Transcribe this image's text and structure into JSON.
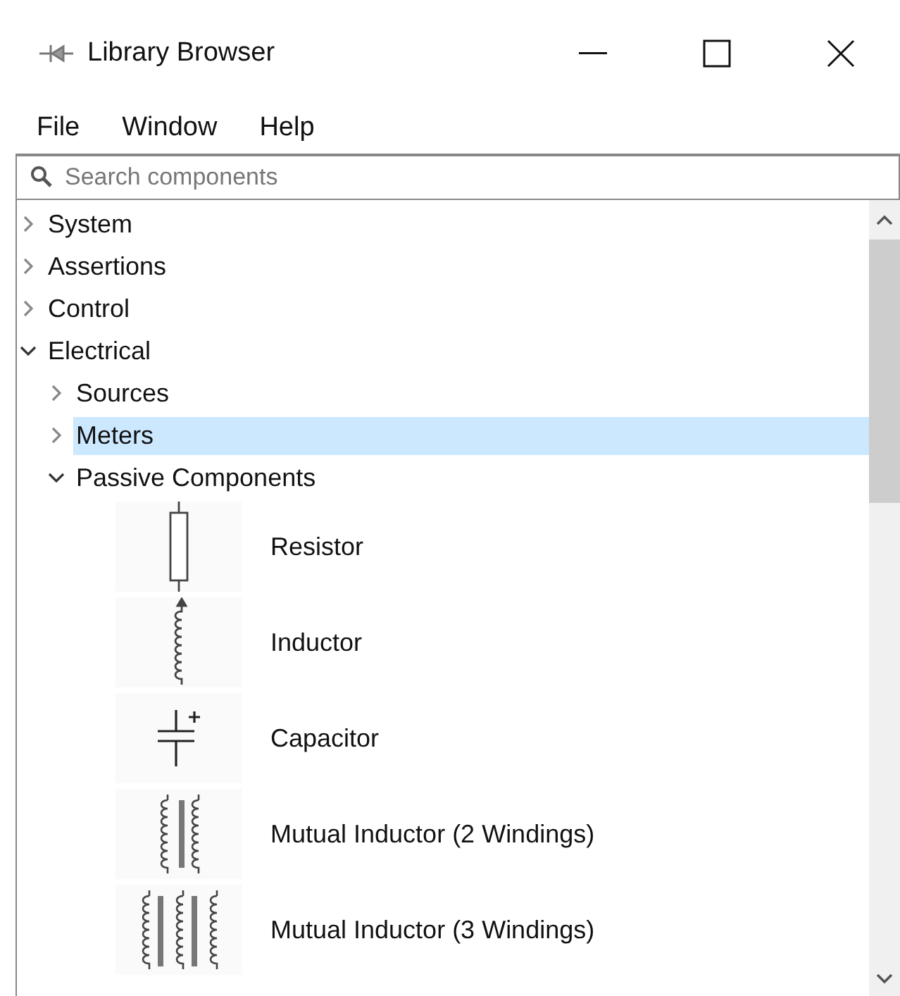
{
  "window": {
    "title": "Library Browser"
  },
  "menu": [
    "File",
    "Window",
    "Help"
  ],
  "search": {
    "placeholder": "Search components"
  },
  "tree": [
    {
      "kind": "group",
      "label": "System",
      "expanded": false,
      "selected": false
    },
    {
      "kind": "group",
      "label": "Assertions",
      "expanded": false,
      "selected": false
    },
    {
      "kind": "group",
      "label": "Control",
      "expanded": false,
      "selected": false
    },
    {
      "kind": "group",
      "label": "Electrical",
      "expanded": true,
      "selected": false,
      "children": [
        {
          "kind": "group",
          "label": "Sources",
          "expanded": false,
          "selected": false
        },
        {
          "kind": "group",
          "label": "Meters",
          "expanded": false,
          "selected": true
        },
        {
          "kind": "group",
          "label": "Passive Components",
          "expanded": true,
          "selected": false,
          "children": [
            {
              "kind": "resistor",
              "label": "Resistor",
              "selected": false
            },
            {
              "kind": "inductor",
              "label": "Inductor",
              "selected": false
            },
            {
              "kind": "capacitor",
              "label": "Capacitor",
              "selected": false
            },
            {
              "kind": "mutual2",
              "label": "Mutual Inductor (2 Windings)",
              "selected": false
            },
            {
              "kind": "mutual3",
              "label": "Mutual Inductor (3 Windings)",
              "selected": false
            }
          ]
        }
      ]
    }
  ]
}
